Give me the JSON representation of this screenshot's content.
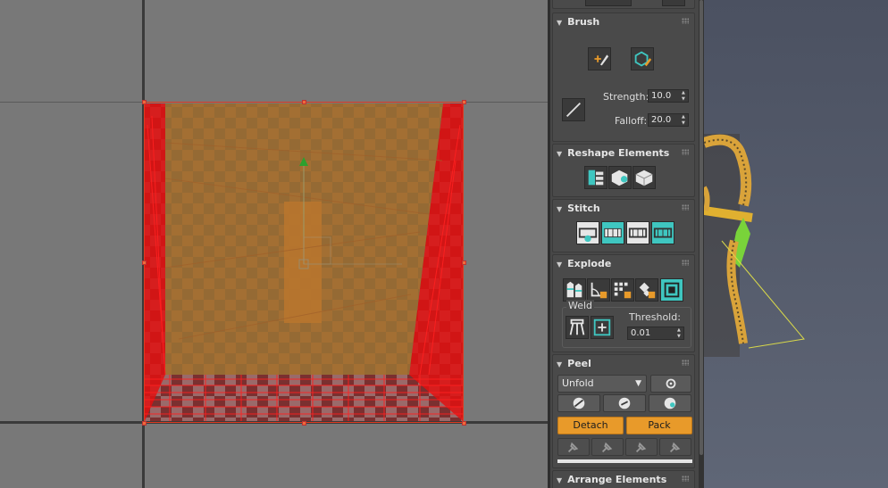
{
  "colors": {
    "accent_orange": "#e89a2a",
    "uv_red": "#ff1a1a",
    "uv_fill": "#b47a2e",
    "teal_icon": "#3fc6c0",
    "panel_bg": "#474747",
    "viewport_bg": "#787878"
  },
  "brush": {
    "title": "Brush",
    "move_icon": "brush-move-icon",
    "relax_icon": "brush-relax-icon",
    "line_icon": "brush-line-icon",
    "strength_label": "Strength:",
    "strength_value": "10.0",
    "falloff_label": "Falloff:",
    "falloff_value": "20.0"
  },
  "reshape": {
    "title": "Reshape Elements",
    "icons": [
      "straighten-icon",
      "relax-icon",
      "flatten-icon"
    ]
  },
  "stitch": {
    "title": "Stitch",
    "icons": [
      "stitch-custom-icon",
      "stitch-target-icon",
      "stitch-average-icon",
      "stitch-source-icon"
    ]
  },
  "explode": {
    "title": "Explode",
    "icons": [
      "explode-by-smoothing-icon",
      "explode-by-angle-icon",
      "explode-by-material-icon",
      "explode-by-polygon-icon",
      "explode-to-elements-icon"
    ],
    "weld": {
      "title": "Weld",
      "icons": [
        "weld-selected-icon",
        "weld-all-icon"
      ],
      "threshold_label": "Threshold:",
      "threshold_value": "0.01"
    }
  },
  "peel": {
    "title": "Peel",
    "mode_value": "Unfold",
    "settings_icon": "gear-icon",
    "tool_icons": [
      "quick-peel-icon",
      "peel-mode-icon",
      "reset-peel-icon"
    ],
    "detach_label": "Detach",
    "pack_label": "Pack",
    "pin_icons": [
      "pin-icon",
      "unpin-icon",
      "pin-edges-icon",
      "unpin-all-icon"
    ]
  },
  "arrange": {
    "title": "Arrange Elements"
  }
}
